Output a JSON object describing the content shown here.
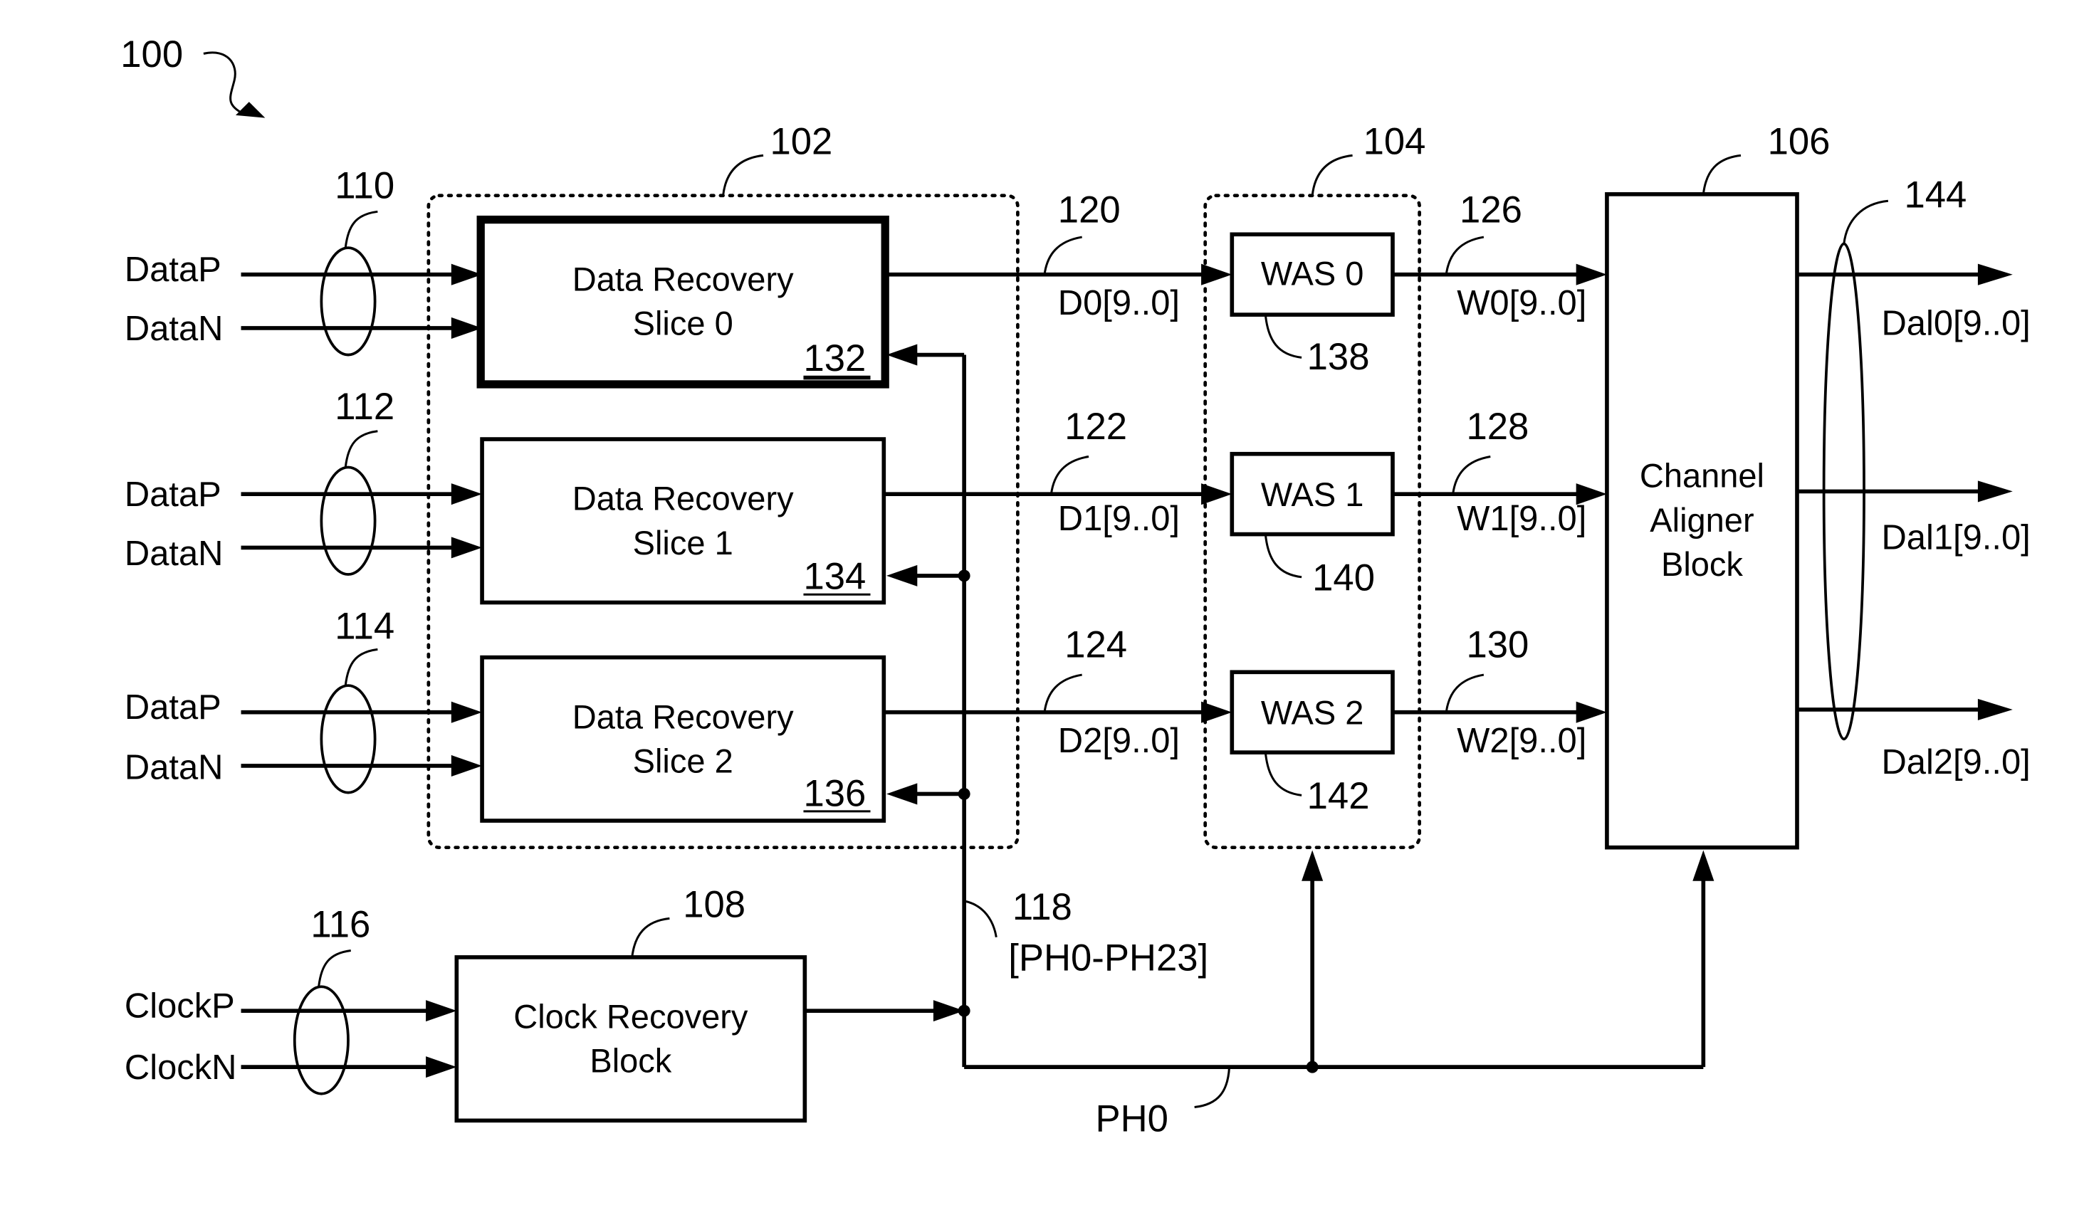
{
  "figure": {
    "ref": "100",
    "inputs": {
      "data_p": "DataP",
      "data_n": "DataN",
      "clock_p": "ClockP",
      "clock_n": "ClockN"
    },
    "bundles": [
      "110",
      "112",
      "114",
      "116",
      "144"
    ],
    "groups": {
      "slice_group": "102",
      "was_group": "104"
    },
    "slices": [
      {
        "line1": "Data Recovery",
        "line2": "Slice 0",
        "ref": "132",
        "out_ref": "120",
        "out_bus": "D0[9..0]"
      },
      {
        "line1": "Data Recovery",
        "line2": "Slice 1",
        "ref": "134",
        "out_ref": "122",
        "out_bus": "D1[9..0]"
      },
      {
        "line1": "Data Recovery",
        "line2": "Slice 2",
        "ref": "136",
        "out_ref": "124",
        "out_bus": "D2[9..0]"
      }
    ],
    "was": [
      {
        "label": "WAS 0",
        "ref": "138",
        "out_ref": "126",
        "out_bus": "W0[9..0]"
      },
      {
        "label": "WAS 1",
        "ref": "140",
        "out_ref": "128",
        "out_bus": "W1[9..0]"
      },
      {
        "label": "WAS 2",
        "ref": "142",
        "out_ref": "130",
        "out_bus": "W2[9..0]"
      }
    ],
    "aligner": {
      "line1": "Channel",
      "line2": "Aligner",
      "line3": "Block",
      "ref": "106"
    },
    "outputs": [
      "Dal0[9..0]",
      "Dal1[9..0]",
      "Dal2[9..0]"
    ],
    "clock_block": {
      "line1": "Clock Recovery",
      "line2": "Block",
      "ref": "108"
    },
    "phase_bus": {
      "ref": "118",
      "label": "[PH0-PH23]"
    },
    "ph0": "PH0"
  }
}
